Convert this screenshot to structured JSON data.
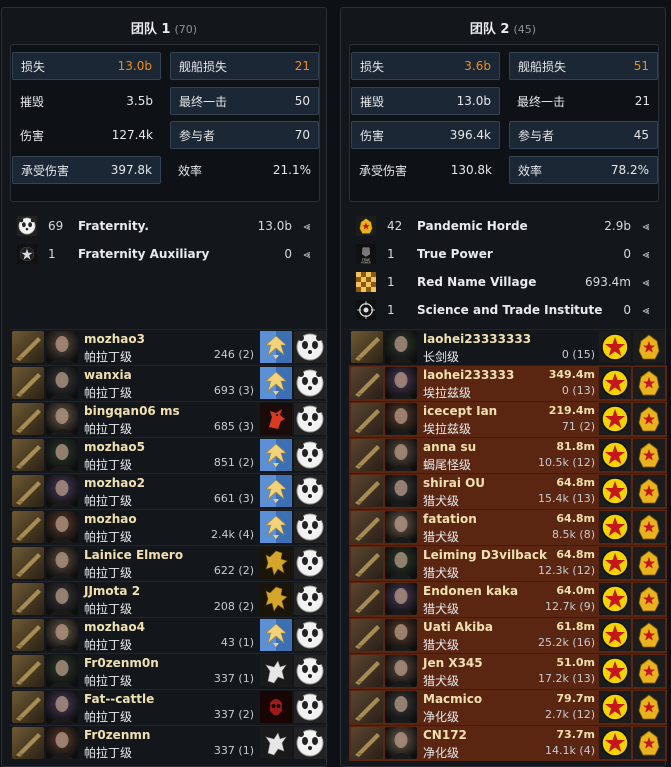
{
  "team1": {
    "title": "团队 1",
    "count": "(70)",
    "stats": [
      {
        "label": "损失",
        "value": "13.0b",
        "orange": true,
        "hl": true
      },
      {
        "label": "舰船损失",
        "value": "21",
        "orange": true,
        "hl": true
      },
      {
        "label": "摧毁",
        "value": "3.5b",
        "orange": false,
        "hl": false
      },
      {
        "label": "最终一击",
        "value": "50",
        "orange": false,
        "hl": true
      },
      {
        "label": "伤害",
        "value": "127.4k",
        "orange": false,
        "hl": false
      },
      {
        "label": "参与者",
        "value": "70",
        "orange": false,
        "hl": true
      },
      {
        "label": "承受伤害",
        "value": "397.8k",
        "orange": false,
        "hl": true
      },
      {
        "label": "效率",
        "value": "21.1%",
        "orange": false,
        "hl": false
      }
    ],
    "groups": [
      {
        "num": "69",
        "name": "Fraternity.",
        "value": "13.0b",
        "icon": "panda-icon"
      },
      {
        "num": "1",
        "name": "Fraternity Auxiliary",
        "value": "0",
        "icon": "star-logo-icon"
      }
    ],
    "rows": [
      {
        "name": "mozhao3",
        "ship": "帕拉丁级",
        "value": "",
        "dmg": "246 (2)",
        "corp": "eagle",
        "red": false
      },
      {
        "name": "wanxia",
        "ship": "帕拉丁级",
        "value": "",
        "dmg": "693 (3)",
        "corp": "eagle",
        "red": false
      },
      {
        "name": "bingqan06 ms",
        "ship": "帕拉丁级",
        "value": "",
        "dmg": "685 (3)",
        "corp": "horse",
        "red": false
      },
      {
        "name": "mozhao5",
        "ship": "帕拉丁级",
        "value": "",
        "dmg": "851 (2)",
        "corp": "eagle",
        "red": false
      },
      {
        "name": "mozhao2",
        "ship": "帕拉丁级",
        "value": "",
        "dmg": "661 (3)",
        "corp": "eagle",
        "red": false
      },
      {
        "name": "mozhao",
        "ship": "帕拉丁级",
        "value": "",
        "dmg": "2.4k (4)",
        "corp": "eagle",
        "red": false
      },
      {
        "name": "Lainice Elmero",
        "ship": "帕拉丁级",
        "value": "",
        "dmg": "622 (2)",
        "corp": "griffin",
        "red": false
      },
      {
        "name": "JJmota 2",
        "ship": "帕拉丁级",
        "value": "",
        "dmg": "208 (2)",
        "corp": "griffin",
        "red": false
      },
      {
        "name": "mozhao4",
        "ship": "帕拉丁级",
        "value": "",
        "dmg": "43 (1)",
        "corp": "eagle",
        "red": false
      },
      {
        "name": "Fr0zenm0n",
        "ship": "帕拉丁级",
        "value": "",
        "dmg": "337 (1)",
        "corp": "white-beast",
        "red": false
      },
      {
        "name": "Fat--cattle",
        "ship": "帕拉丁级",
        "value": "",
        "dmg": "337 (2)",
        "corp": "red-skull",
        "red": false
      },
      {
        "name": "Fr0zenmn",
        "ship": "帕拉丁级",
        "value": "",
        "dmg": "337 (1)",
        "corp": "white-beast",
        "red": false
      }
    ]
  },
  "team2": {
    "title": "团队 2",
    "count": "(45)",
    "stats": [
      {
        "label": "损失",
        "value": "3.6b",
        "orange": true,
        "hl": true
      },
      {
        "label": "舰船损失",
        "value": "51",
        "orange": true,
        "hl": true
      },
      {
        "label": "摧毁",
        "value": "13.0b",
        "orange": false,
        "hl": true
      },
      {
        "label": "最终一击",
        "value": "21",
        "orange": false,
        "hl": false
      },
      {
        "label": "伤害",
        "value": "396.4k",
        "orange": false,
        "hl": true
      },
      {
        "label": "参与者",
        "value": "45",
        "orange": false,
        "hl": true
      },
      {
        "label": "承受伤害",
        "value": "130.8k",
        "orange": false,
        "hl": false
      },
      {
        "label": "效率",
        "value": "78.2%",
        "orange": false,
        "hl": true
      }
    ],
    "groups": [
      {
        "num": "42",
        "name": "Pandemic Horde",
        "value": "2.9b",
        "icon": "horde-icon"
      },
      {
        "num": "1",
        "name": "True Power",
        "value": "0",
        "icon": "true-power-icon"
      },
      {
        "num": "1",
        "name": "Red Name Village",
        "value": "693.4m",
        "icon": "checker-icon"
      },
      {
        "num": "1",
        "name": "Science and Trade Institute",
        "value": "0",
        "icon": "scope-icon"
      }
    ],
    "rows": [
      {
        "name": "laohei23333333",
        "ship": "长剑级",
        "value": "",
        "dmg": "0 (15)",
        "red": false
      },
      {
        "name": "laohei233333",
        "ship": "埃拉兹级",
        "value": "349.4m",
        "dmg": "0 (13)",
        "red": true
      },
      {
        "name": "icecept Ian",
        "ship": "埃拉兹级",
        "value": "219.4m",
        "dmg": "71 (2)",
        "red": true
      },
      {
        "name": "anna su",
        "ship": "蝎尾怪级",
        "value": "81.8m",
        "dmg": "10.5k (12)",
        "red": true
      },
      {
        "name": "shirai OU",
        "ship": "猎犬级",
        "value": "64.8m",
        "dmg": "15.4k (13)",
        "red": true
      },
      {
        "name": "fatation",
        "ship": "猎犬级",
        "value": "64.8m",
        "dmg": "8.5k (8)",
        "red": true
      },
      {
        "name": "Leiming D3vilback",
        "ship": "猎犬级",
        "value": "64.8m",
        "dmg": "12.3k (12)",
        "red": true
      },
      {
        "name": "Endonen kaka",
        "ship": "猎犬级",
        "value": "64.0m",
        "dmg": "12.7k (9)",
        "red": true
      },
      {
        "name": "Uati Akiba",
        "ship": "猎犬级",
        "value": "61.8m",
        "dmg": "25.2k (16)",
        "red": true
      },
      {
        "name": "Jen X345",
        "ship": "猎犬级",
        "value": "51.0m",
        "dmg": "17.2k (13)",
        "red": true
      },
      {
        "name": "Macmico",
        "ship": "净化级",
        "value": "79.7m",
        "dmg": "2.7k (12)",
        "red": true
      },
      {
        "name": "CN172",
        "ship": "净化级",
        "value": "73.7m",
        "dmg": "14.1k (4)",
        "red": true
      }
    ]
  },
  "share_glyph": "⪡"
}
